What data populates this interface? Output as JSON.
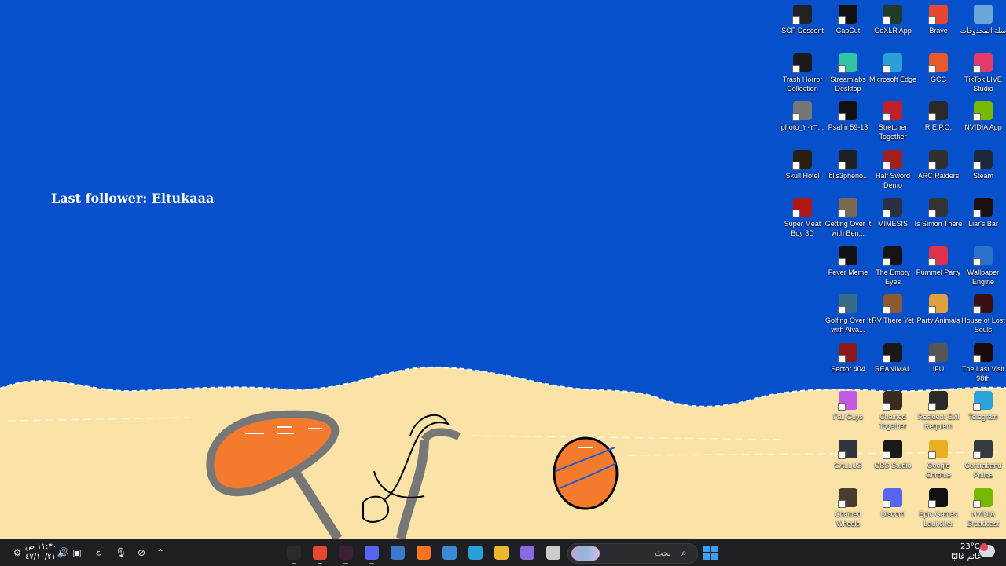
{
  "wallpaper": {
    "follower_text": "Last follower: Eltukaaa",
    "sky_color": "#0750cc",
    "sand_color": "#fbe3a8",
    "umbrella_color": "#f47a2e",
    "ball_color": "#f47a2e"
  },
  "desktop_icons": [
    {
      "label": "سلة المحذوفات",
      "icon": "recycle-bin-icon",
      "color": "#6aa7d8"
    },
    {
      "label": "Brave",
      "icon": "brave-icon",
      "color": "#e8472f"
    },
    {
      "label": "GoXLR App",
      "icon": "goxlr-icon",
      "color": "#1f3b2c"
    },
    {
      "label": "CapCut",
      "icon": "capcut-icon",
      "color": "#111111"
    },
    {
      "label": "SCP Descent",
      "icon": "scp-descent-icon",
      "color": "#222222"
    },
    {
      "label": "TikTok LIVE Studio",
      "icon": "tiktok-live-icon",
      "color": "#e83a6a"
    },
    {
      "label": "GCC",
      "icon": "gcc-icon",
      "color": "#e85a2b"
    },
    {
      "label": "Microsoft Edge",
      "icon": "edge-icon",
      "color": "#2aa0d8"
    },
    {
      "label": "Streamlabs Desktop",
      "icon": "streamlabs-icon",
      "color": "#31c3a2"
    },
    {
      "label": "Trash Horror Collection",
      "icon": "trash-horror-icon",
      "color": "#1a1a1a"
    },
    {
      "label": "NVIDIA App",
      "icon": "nvidia-icon",
      "color": "#76b900"
    },
    {
      "label": "R.E.P.O.",
      "icon": "repo-icon",
      "color": "#2a2a2a"
    },
    {
      "label": "Stretcher Together",
      "icon": "stretcher-icon",
      "color": "#c0202a"
    },
    {
      "label": "Psalm 59-13",
      "icon": "psalm-icon",
      "color": "#101010"
    },
    {
      "label": "photo_٢٠٢٦...",
      "icon": "photo-icon",
      "color": "#777777"
    },
    {
      "label": "Steam",
      "icon": "steam-icon",
      "color": "#1b2838"
    },
    {
      "label": "ARC Raiders",
      "icon": "arc-raiders-icon",
      "color": "#303030"
    },
    {
      "label": "Half Sword Demo",
      "icon": "half-sword-icon",
      "color": "#a02020"
    },
    {
      "label": "iblis3pheno...",
      "icon": "iblis-icon",
      "color": "#202020"
    },
    {
      "label": "Skull Hotel",
      "icon": "skull-hotel-icon",
      "color": "#2a2012"
    },
    {
      "label": "Liar's Bar",
      "icon": "liars-bar-icon",
      "color": "#1a1010"
    },
    {
      "label": "Is Simon There",
      "icon": "is-simon-there-icon",
      "color": "#333333"
    },
    {
      "label": "MIMESIS",
      "icon": "mimesis-icon",
      "color": "#2a3040"
    },
    {
      "label": "Getting Over It with Ben...",
      "icon": "getting-over-it-icon",
      "color": "#7a6a50"
    },
    {
      "label": "Super Meat Boy 3D",
      "icon": "super-meat-boy-icon",
      "color": "#b01818"
    },
    {
      "label": "Wallpaper Engine",
      "icon": "wallpaper-engine-icon",
      "color": "#2a72c8"
    },
    {
      "label": "Pummel Party",
      "icon": "pummel-party-icon",
      "color": "#e0304a"
    },
    {
      "label": "The Empty Eyes",
      "icon": "empty-eyes-icon",
      "color": "#141414"
    },
    {
      "label": "Fever Meme",
      "icon": "fever-meme-icon",
      "color": "#111111"
    },
    {
      "label": "House of Lost Souls",
      "icon": "house-lost-souls-icon",
      "color": "#3a1010"
    },
    {
      "label": "Party Animals",
      "icon": "party-animals-icon",
      "color": "#e0a040"
    },
    {
      "label": "RV There Yet",
      "icon": "rv-there-yet-icon",
      "color": "#8a5a30"
    },
    {
      "label": "Golfing Over It with Alva...",
      "icon": "golfing-over-it-icon",
      "color": "#3a6a8a"
    },
    {
      "label": "The Last Visit 98th",
      "icon": "last-visit-icon",
      "color": "#1a0a0a"
    },
    {
      "label": "IFU",
      "icon": "ifu-icon",
      "color": "#555555"
    },
    {
      "label": "REANIMAL",
      "icon": "reanimal-icon",
      "color": "#181818"
    },
    {
      "label": "Sector 404",
      "icon": "sector-404-icon",
      "color": "#8a1a1a"
    },
    {
      "label": "Telegram",
      "icon": "telegram-icon",
      "color": "#2aa3de"
    },
    {
      "label": "Resident Evil Requiem",
      "icon": "resident-evil-icon",
      "color": "#2a2a2a"
    },
    {
      "label": "Chained Together",
      "icon": "chained-together-icon",
      "color": "#3a2a20"
    },
    {
      "label": "Fall Guys",
      "icon": "fall-guys-icon",
      "color": "#c05ae0"
    },
    {
      "label": "Contraband Police",
      "icon": "contraband-police-icon",
      "color": "#333a40"
    },
    {
      "label": "Google Chrome",
      "icon": "chrome-icon",
      "color": "#e8b020"
    },
    {
      "label": "OBS Studio",
      "icon": "obs-studio-icon",
      "color": "#1a1a1a"
    },
    {
      "label": "CALLUS",
      "icon": "callus-icon",
      "color": "#303540"
    },
    {
      "label": "NVIDIA Broadcast",
      "icon": "nvidia-broadcast-icon",
      "color": "#76b900"
    },
    {
      "label": "Epic Games Launcher",
      "icon": "epic-games-icon",
      "color": "#111111"
    },
    {
      "label": "Discord",
      "icon": "discord-icon",
      "color": "#5865f2"
    },
    {
      "label": "Chained Wheels",
      "icon": "chained-wheels-icon",
      "color": "#4a3a30"
    }
  ],
  "taskbar": {
    "search_placeholder": "بحث",
    "weather_temp": "23°C",
    "weather_desc": "غائم غالبًا",
    "clock_time": "١١:٣٠ ص",
    "clock_date": "٤٧/١٠/٢١",
    "language": "ع",
    "apps": [
      {
        "icon": "obs-taskbar-icon",
        "color": "#2a2a2a",
        "active": true
      },
      {
        "icon": "brave-taskbar-icon",
        "color": "#e8472f",
        "active": true
      },
      {
        "icon": "goxlr-taskbar-icon",
        "color": "#3a2030",
        "active": true
      },
      {
        "icon": "discord-taskbar-icon",
        "color": "#5865f2",
        "active": true
      },
      {
        "icon": "screenshot-taskbar-icon",
        "color": "#3a7ac8",
        "active": false
      },
      {
        "icon": "crunchyroll-taskbar-icon",
        "color": "#f47521",
        "active": false
      },
      {
        "icon": "store-taskbar-icon",
        "color": "#3a8ad8",
        "active": false
      },
      {
        "icon": "edge-taskbar-icon",
        "color": "#2aa0d8",
        "active": false
      },
      {
        "icon": "explorer-taskbar-icon",
        "color": "#e8b830",
        "active": false
      },
      {
        "icon": "copilot-taskbar-icon",
        "color": "#8a6ae0",
        "active": false
      },
      {
        "icon": "task-view-icon",
        "color": "#cccccc",
        "active": false
      }
    ]
  }
}
